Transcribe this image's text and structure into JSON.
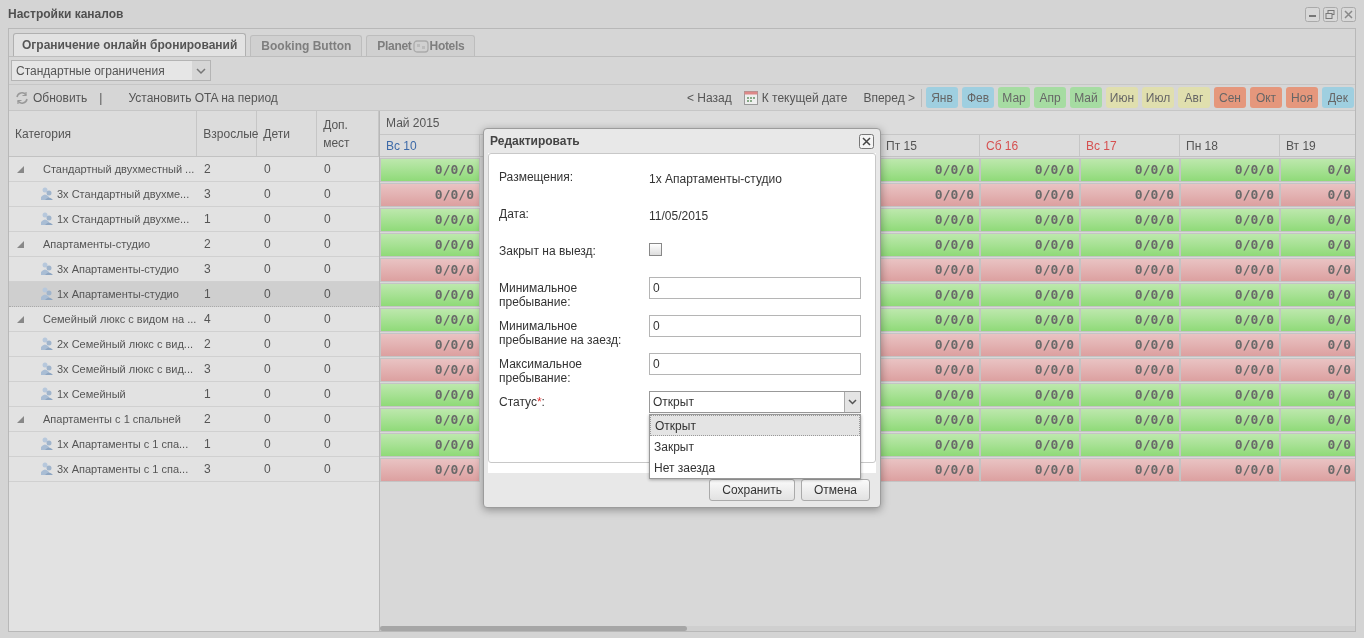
{
  "window": {
    "title": "Настройки каналов"
  },
  "tabs": [
    {
      "kind": "text",
      "label": "Ограничение онлайн бронирований",
      "selected": true
    },
    {
      "kind": "text",
      "label": "Booking Button",
      "selected": false
    },
    {
      "kind": "logo",
      "label": "Planet",
      "label_2": "Hotels",
      "selected": false
    }
  ],
  "filter": {
    "value": "Стандартные ограничения"
  },
  "toolbar": {
    "refresh": "Обновить",
    "separator": "|",
    "set_ota": "Установить OTA на период",
    "back": "< Назад",
    "today": "К текущей дате",
    "forward": "Вперед >"
  },
  "months": [
    {
      "label": "Янв",
      "color": "#9fcfe0"
    },
    {
      "label": "Фев",
      "color": "#9fcfe0"
    },
    {
      "label": "Мар",
      "color": "#a6dca2"
    },
    {
      "label": "Апр",
      "color": "#a6dca2"
    },
    {
      "label": "Май",
      "color": "#a6dca2"
    },
    {
      "label": "Июн",
      "color": "#e0dfae"
    },
    {
      "label": "Июл",
      "color": "#e0dfae"
    },
    {
      "label": "Авг",
      "color": "#e0dfae"
    },
    {
      "label": "Сен",
      "color": "#e5977c"
    },
    {
      "label": "Окт",
      "color": "#e5977c"
    },
    {
      "label": "Ноя",
      "color": "#e5977c"
    },
    {
      "label": "Дек",
      "color": "#9fcfe0"
    }
  ],
  "table": {
    "columns": [
      "Категория",
      "Взрослые",
      "Дети",
      "Доп. мест"
    ],
    "month": "Май 2015",
    "days": [
      {
        "label": "Вс 10",
        "weekend": false,
        "selected": true
      },
      {
        "label": "Пт 15",
        "weekend": false,
        "selected": false
      },
      {
        "label": "Сб 16",
        "weekend": true,
        "selected": false
      },
      {
        "label": "Вс 17",
        "weekend": true,
        "selected": false
      },
      {
        "label": "Пн 18",
        "weekend": false,
        "selected": false
      },
      {
        "label": "Вт 19",
        "weekend": false,
        "selected": false
      }
    ],
    "rows": [
      {
        "name": "Стандартный двухместный ...",
        "adults": "2",
        "kids": "0",
        "extra": "0",
        "expanded": true,
        "selected": false,
        "open": true,
        "cells": [
          "0/0/0",
          "0/0/0",
          "0/0/0",
          "0/0/0",
          "0/0/0",
          "0/0"
        ],
        "children": [
          {
            "name": "3x Стандартный двухме...",
            "adults": "3",
            "kids": "0",
            "extra": "0",
            "selected": false,
            "open": false,
            "cells": [
              "0/0/0",
              "0/0/0",
              "0/0/0",
              "0/0/0",
              "0/0/0",
              "0/0"
            ]
          },
          {
            "name": "1x Стандартный двухме...",
            "adults": "1",
            "kids": "0",
            "extra": "0",
            "selected": false,
            "open": true,
            "cells": [
              "0/0/0",
              "0/0/0",
              "0/0/0",
              "0/0/0",
              "0/0/0",
              "0/0"
            ]
          }
        ]
      },
      {
        "name": "Апартаменты-студио",
        "adults": "2",
        "kids": "0",
        "extra": "0",
        "expanded": true,
        "selected": false,
        "open": true,
        "cells": [
          "0/0/0",
          "0/0/0",
          "0/0/0",
          "0/0/0",
          "0/0/0",
          "0/0"
        ],
        "children": [
          {
            "name": "3x Апартаменты-студио",
            "adults": "3",
            "kids": "0",
            "extra": "0",
            "selected": false,
            "open": false,
            "cells": [
              "0/0/0",
              "0/0/0",
              "0/0/0",
              "0/0/0",
              "0/0/0",
              "0/0"
            ]
          },
          {
            "name": "1x Апартаменты-студио",
            "adults": "1",
            "kids": "0",
            "extra": "0",
            "selected": true,
            "open": true,
            "cells": [
              "0/0/0",
              "0/0/0",
              "0/0/0",
              "0/0/0",
              "0/0/0",
              "0/0"
            ]
          }
        ]
      },
      {
        "name": "Семейный люкс с видом на ...",
        "adults": "4",
        "kids": "0",
        "extra": "0",
        "expanded": true,
        "selected": false,
        "open": true,
        "cells": [
          "0/0/0",
          "0/0/0",
          "0/0/0",
          "0/0/0",
          "0/0/0",
          "0/0"
        ],
        "children": [
          {
            "name": "2x Семейный люкс с вид...",
            "adults": "2",
            "kids": "0",
            "extra": "0",
            "selected": false,
            "open": false,
            "cells": [
              "0/0/0",
              "0/0/0",
              "0/0/0",
              "0/0/0",
              "0/0/0",
              "0/0"
            ]
          },
          {
            "name": "3x Семейный люкс с вид...",
            "adults": "3",
            "kids": "0",
            "extra": "0",
            "selected": false,
            "open": false,
            "cells": [
              "0/0/0",
              "0/0/0",
              "0/0/0",
              "0/0/0",
              "0/0/0",
              "0/0"
            ]
          },
          {
            "name": "1x Семейный",
            "adults": "1",
            "kids": "0",
            "extra": "0",
            "selected": false,
            "open": true,
            "cells": [
              "0/0/0",
              "0/0/0",
              "0/0/0",
              "0/0/0",
              "0/0/0",
              "0/0"
            ]
          }
        ]
      },
      {
        "name": "Апартаменты с 1 спальней",
        "adults": "2",
        "kids": "0",
        "extra": "0",
        "expanded": true,
        "selected": false,
        "open": true,
        "cells": [
          "0/0/0",
          "0/0/0",
          "0/0/0",
          "0/0/0",
          "0/0/0",
          "0/0"
        ],
        "children": [
          {
            "name": "1x Апартаменты с 1 спа...",
            "adults": "1",
            "kids": "0",
            "extra": "0",
            "selected": false,
            "open": true,
            "cells": [
              "0/0/0",
              "0/0/0",
              "0/0/0",
              "0/0/0",
              "0/0/0",
              "0/0"
            ]
          },
          {
            "name": "3x Апартаменты с 1 спа...",
            "adults": "3",
            "kids": "0",
            "extra": "0",
            "selected": false,
            "open": false,
            "cells": [
              "0/0/0",
              "0/0/0",
              "0/0/0",
              "0/0/0",
              "0/0/0",
              "0/0"
            ]
          }
        ]
      }
    ]
  },
  "dialog": {
    "title": "Редактировать",
    "fields": [
      {
        "kind": "text",
        "label": "Размещения:",
        "value": "1x Апартаменты-студио"
      },
      {
        "kind": "text",
        "label": "Дата:",
        "value": "11/05/2015"
      },
      {
        "kind": "checkbox",
        "label": "Закрыт на выезд:",
        "checked": false
      },
      {
        "kind": "input",
        "label": "Минимальное пребывание:",
        "value": "0"
      },
      {
        "kind": "input",
        "label": "Минимальное пребывание на заезд:",
        "value": "0"
      },
      {
        "kind": "input",
        "label": "Максимальное пребывание:",
        "value": "0"
      },
      {
        "kind": "select",
        "label": "Статус",
        "required_mark": "*",
        "label_end": ":",
        "value": "Открыт",
        "expanded": true,
        "options": [
          {
            "label": "Открыт",
            "selected": true
          },
          {
            "label": "Закрыт",
            "selected": false
          },
          {
            "label": "Нет заезда",
            "selected": false
          }
        ]
      }
    ],
    "buttons": [
      "Сохранить",
      "Отмена"
    ]
  }
}
